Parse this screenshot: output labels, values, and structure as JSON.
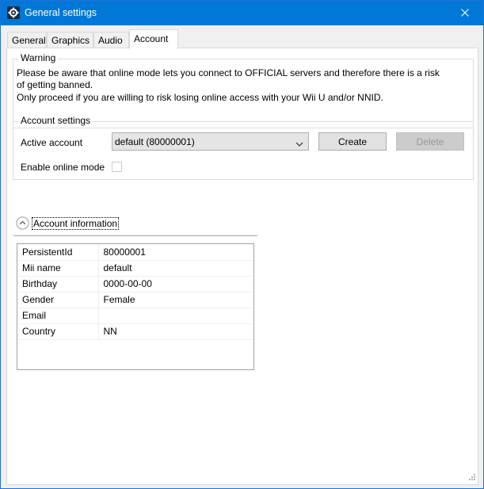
{
  "window": {
    "title": "General settings",
    "app_icon": "gear-icon",
    "close_icon": "close-icon"
  },
  "tabs": [
    {
      "label": "General"
    },
    {
      "label": "Graphics"
    },
    {
      "label": "Audio"
    },
    {
      "label": "Account"
    }
  ],
  "active_tab": "Account",
  "warning": {
    "title": "Warning",
    "lines": [
      "Please be aware that online mode lets you connect to OFFICIAL servers and therefore there is a risk",
      "of getting banned.",
      "Only proceed if you are willing to risk losing online access with your Wii U and/or NNID."
    ]
  },
  "account_settings": {
    "title": "Account settings",
    "active_account_label": "Active account",
    "active_account_value": "default (80000001)",
    "create_label": "Create",
    "delete_label": "Delete",
    "online_mode_label": "Enable online mode",
    "online_mode_checked": false
  },
  "account_info": {
    "title": "Account information",
    "toggle_icon": "chevron-up-circle-icon",
    "rows": [
      {
        "key": "PersistentId",
        "value": "80000001"
      },
      {
        "key": "Mii name",
        "value": "default"
      },
      {
        "key": "Birthday",
        "value": "0000-00-00"
      },
      {
        "key": "Gender",
        "value": "Female"
      },
      {
        "key": "Email",
        "value": ""
      },
      {
        "key": "Country",
        "value": "NN"
      }
    ]
  },
  "colors": {
    "titlebar": "#0078d7",
    "window_bg": "#f0f0f0",
    "panel_bg": "#ffffff"
  }
}
